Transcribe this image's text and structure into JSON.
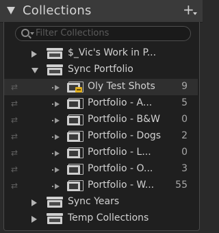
{
  "panel": {
    "title": "Collections",
    "add_label": "+"
  },
  "search": {
    "placeholder": "Filter Collections"
  },
  "items": [
    {
      "label": "$_Vic's Work in P...",
      "type": "set",
      "state": "collapsed"
    },
    {
      "label": "Sync Portfolio",
      "type": "set",
      "state": "expanded"
    },
    {
      "label": "Oly Test Shots",
      "type": "collection",
      "count": "9",
      "synced": true,
      "badge": true
    },
    {
      "label": "Portfolio - A...",
      "type": "collection",
      "count": "5",
      "synced": true
    },
    {
      "label": "Portfolio - B&W",
      "type": "collection",
      "count": "0",
      "synced": true
    },
    {
      "label": "Portfolio - Dogs",
      "type": "collection",
      "count": "2",
      "synced": true
    },
    {
      "label": "Portfolio - L...",
      "type": "collection",
      "count": "0",
      "synced": true
    },
    {
      "label": "Portfolio - O...",
      "type": "collection",
      "count": "3",
      "synced": true
    },
    {
      "label": "Portfolio - W...",
      "type": "collection",
      "count": "55",
      "synced": true
    },
    {
      "label": "Sync Years",
      "type": "set",
      "state": "collapsed"
    },
    {
      "label": "Temp Collections",
      "type": "set",
      "state": "collapsed"
    }
  ],
  "icons": {
    "sync": "sync-icon",
    "set": "collection-set-icon",
    "collection": "collection-icon",
    "target_badge": "target-collection-badge-icon"
  }
}
